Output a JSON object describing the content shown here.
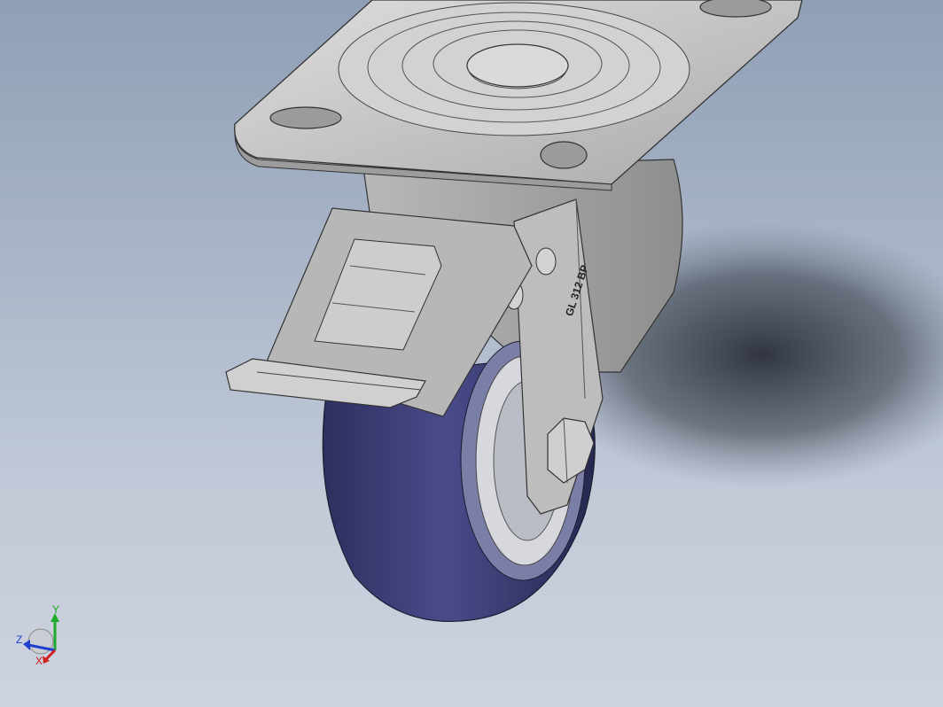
{
  "viewport": {
    "background_top": "#8f9fb6",
    "background_bottom": "#cdd3df"
  },
  "model": {
    "part_label": "GL 312 BP",
    "wheel_color": "#3d3f7a",
    "metal_color": "#c8c8c8"
  },
  "triad": {
    "x_label": "X",
    "y_label": "Y",
    "z_label": "Z",
    "x_color": "#d22020",
    "y_color": "#1faa2a",
    "z_color": "#1f3fd0"
  }
}
